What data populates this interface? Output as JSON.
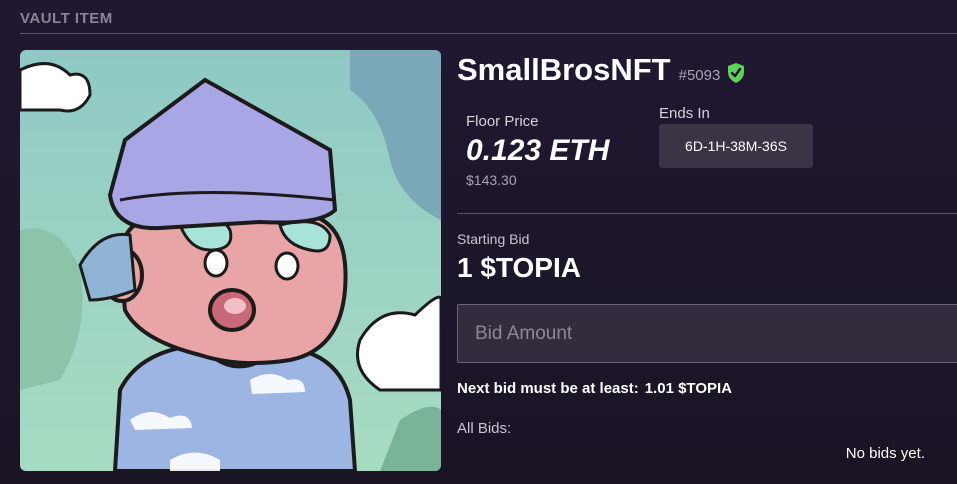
{
  "section": {
    "title": "VAULT ITEM"
  },
  "item": {
    "name": "SmallBrosNFT",
    "token_id": "#5093",
    "verified_icon": "check-shield-icon"
  },
  "floor": {
    "label": "Floor Price",
    "value": "0.123 ETH",
    "usd": "$143.30"
  },
  "ends": {
    "label": "Ends In",
    "value": "6D-1H-38M-36S"
  },
  "bid": {
    "starting_label": "Starting Bid",
    "starting_value": "1 $TOPIA",
    "input_placeholder": "Bid Amount",
    "next_bid_label": "Next bid must be at least:",
    "next_bid_value": "1.01 $TOPIA",
    "all_bids_label": "All Bids:",
    "empty_text": "No bids yet."
  },
  "colors": {
    "background": "#1c1528",
    "verified_green": "#5ed35a",
    "panel": "#3a3445"
  }
}
